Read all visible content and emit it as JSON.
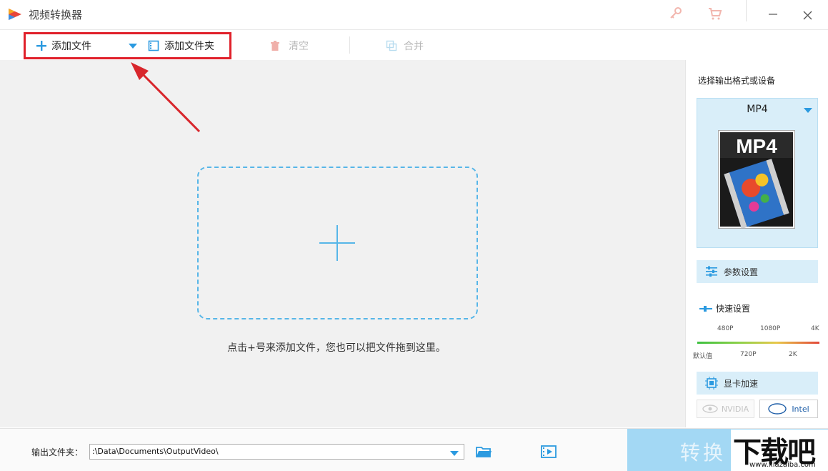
{
  "app": {
    "title": "视频转换器"
  },
  "toolbar": {
    "add_file": "添加文件",
    "add_folder": "添加文件夹",
    "clear": "清空",
    "merge": "合并"
  },
  "main": {
    "drop_hint": "点击+号来添加文件，您也可以把文件拖到这里。"
  },
  "panel": {
    "format_label": "选择输出格式或设备",
    "format_name": "MP4",
    "format_thumb_text": "MP4",
    "param_settings": "参数设置",
    "quick_settings": "快速设置",
    "quality_top": [
      "480P",
      "1080P",
      "4K"
    ],
    "quality_bottom": [
      "默认值",
      "720P",
      "2K"
    ],
    "gpu_accel": "显卡加速",
    "nvidia": "NVIDIA",
    "intel": "Intel"
  },
  "bottom": {
    "output_label": "输出文件夹：",
    "output_path": ":\\Data\\Documents\\OutputVideo\\",
    "convert": "转换"
  },
  "watermark": {
    "text": "下载吧",
    "url": "www.xiazaiba.com"
  },
  "colors": {
    "accent": "#2b9ae0",
    "highlight": "#e0202a",
    "panel_blue": "#d9eef9",
    "convert_bg": "#a3d8f4"
  }
}
